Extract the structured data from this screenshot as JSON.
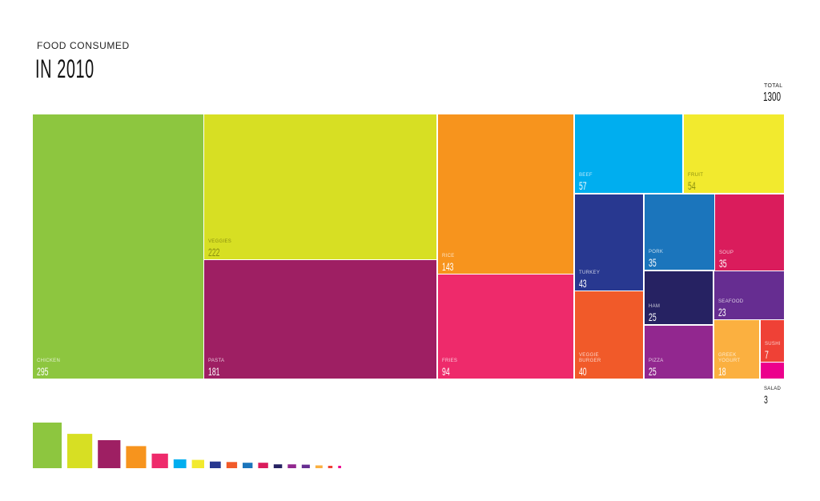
{
  "header": {
    "subtitle": "FOOD CONSUMED",
    "title": "IN 2010",
    "total_label": "TOTAL",
    "total_value": "1300"
  },
  "chart_data": {
    "type": "treemap",
    "total": 1300,
    "items": [
      {
        "name": "CHICKEN",
        "value": 295,
        "color": "#8dc63f"
      },
      {
        "name": "VEGGIES",
        "value": 222,
        "color": "#d7df23"
      },
      {
        "name": "PASTA",
        "value": 181,
        "color": "#9e1f63"
      },
      {
        "name": "RICE",
        "value": 143,
        "color": "#f7941d"
      },
      {
        "name": "FRIES",
        "value": 94,
        "color": "#ee2a6b"
      },
      {
        "name": "BEEF",
        "value": 57,
        "color": "#00aeef"
      },
      {
        "name": "FRUIT",
        "value": 54,
        "color": "#f2ea2e"
      },
      {
        "name": "TURKEY",
        "value": 43,
        "color": "#283890"
      },
      {
        "name": "VEGGIE BURGER",
        "value": 40,
        "color": "#f15a29"
      },
      {
        "name": "PORK",
        "value": 35,
        "color": "#1b75bc"
      },
      {
        "name": "SOUP",
        "value": 35,
        "color": "#da1c5c"
      },
      {
        "name": "HAM",
        "value": 25,
        "color": "#262262"
      },
      {
        "name": "PIZZA",
        "value": 25,
        "color": "#92278f"
      },
      {
        "name": "SEAFOOD",
        "value": 23,
        "color": "#662d91"
      },
      {
        "name": "GREEK YOGURT",
        "value": 18,
        "color": "#fbb040"
      },
      {
        "name": "SUSHI",
        "value": 7,
        "color": "#ef4136"
      },
      {
        "name": "SALAD",
        "value": 3,
        "color": "#ec008c"
      }
    ]
  }
}
